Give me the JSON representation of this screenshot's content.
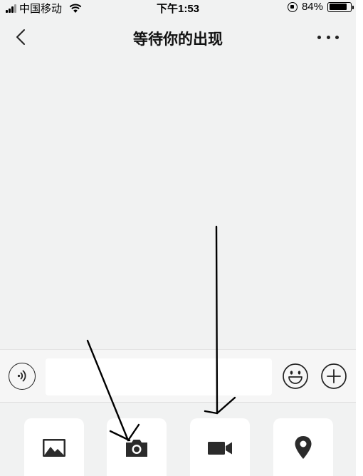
{
  "status_bar": {
    "carrier": "中国移动",
    "time": "下午1:53",
    "battery_percent": "84%",
    "battery_level": 0.84,
    "icons": [
      "signal-icon",
      "wifi-icon",
      "orientation-lock-icon",
      "battery-icon"
    ]
  },
  "nav": {
    "title": "等待你的出现",
    "back_icon": "chevron-left-icon",
    "more_icon": "more-dots-icon"
  },
  "input_bar": {
    "text_value": "",
    "voice_icon": "voice-icon",
    "emoji_icon": "emoji-icon",
    "plus_icon": "plus-icon"
  },
  "tools": [
    {
      "name": "photo-album",
      "icon": "image-icon"
    },
    {
      "name": "camera",
      "icon": "camera-icon"
    },
    {
      "name": "video-call",
      "icon": "video-camera-icon"
    },
    {
      "name": "location",
      "icon": "location-pin-icon"
    }
  ],
  "annotations": {
    "color": "#000000",
    "arrows": [
      "arrow-to-camera",
      "arrow-to-video"
    ]
  },
  "colors": {
    "background": "#f1f2f2",
    "input_bar": "#f6f6f6",
    "tile": "#ffffff",
    "icon": "#222222"
  }
}
